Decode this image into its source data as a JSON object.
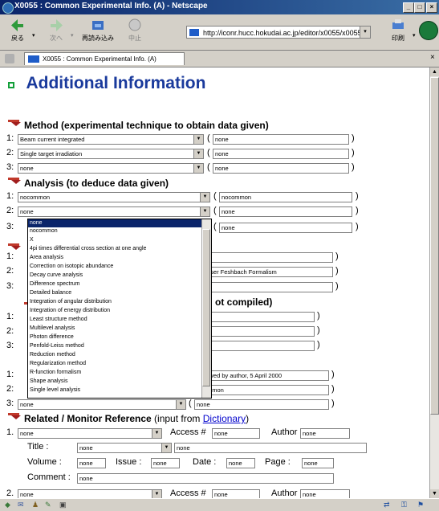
{
  "window": {
    "title": "X0055 : Common Experimental Info. (A) - Netscape",
    "minimize": "_",
    "maximize": "□",
    "close": "×"
  },
  "toolbar": {
    "back": "戻る",
    "forward": "次へ",
    "reload": "再読み込み",
    "stop": "中止",
    "print": "印刷",
    "url": "http://iconr.hucc.hokudai.ac.jp/editor/x0055/x0055-0a"
  },
  "tab": {
    "label": "X0055 : Common Experimental Info. (A)",
    "close": "×"
  },
  "page": {
    "title": "Additional Information",
    "method": {
      "heading": "Method (experimental technique to obtain data given)",
      "rows": [
        {
          "num": "1:",
          "select": "Beam current integrated",
          "input": "none"
        },
        {
          "num": "2:",
          "select": "Single target irradiation",
          "input": "none"
        },
        {
          "num": "3:",
          "select": "none",
          "input": "none"
        }
      ]
    },
    "analysis": {
      "heading": "Analysis (to deduce data given)",
      "rows": [
        {
          "num": "1:",
          "select": "nocommon",
          "input": "nocommon"
        },
        {
          "num": "2:",
          "select": "none",
          "input": "none"
        },
        {
          "num": "3:",
          "select": "",
          "input": "none"
        }
      ]
    },
    "hidden_rows": [
      {
        "num": "1:",
        "input": "e"
      },
      {
        "num": "2:",
        "input": "user Feshbach Formalism"
      },
      {
        "num": "3:",
        "input": "e"
      }
    ],
    "hidden_heading": "ot compiled)",
    "hidden_rows2": [
      {
        "num": "1:",
        "input": ""
      },
      {
        "num": "2:",
        "input": ""
      },
      {
        "num": "3:",
        "input": ""
      }
    ],
    "status_section": {
      "rows": [
        {
          "num": "1:",
          "input": "oved by author, 5 April 2000"
        },
        {
          "num": "2:",
          "input": "mmon"
        },
        {
          "num": "3:",
          "select": "none",
          "input": "none"
        }
      ]
    },
    "dropdown_options": [
      "none",
      "nocommon",
      "X",
      "4pi times differential cross section at one angle",
      "Area analysis",
      "Correction on isotopic abundance",
      "Decay curve analysis",
      "Difference spectrum",
      "Detailed balance",
      "Integration of angular distribution",
      "Integration of energy distribution",
      "Least structure method",
      "Multilevel analysis",
      "Photon difference",
      "Penfold-Leiss method",
      "Reduction method",
      "Regularization method",
      "R-function formalism",
      "Shape analysis",
      "Single level analysis"
    ],
    "related": {
      "heading": "Related / Monitor Reference",
      "heading_note": "(input from",
      "heading_link": "Dictionary",
      "heading_close": ")",
      "access_label": "Access #",
      "author_label": "Author",
      "title_label": "Title :",
      "volume_label": "Volume :",
      "issue_label": "Issue :",
      "date_label": "Date :",
      "page_label": "Page :",
      "comment_label": "Comment :",
      "entry1": {
        "num": "1.",
        "select": "none",
        "access": "none",
        "author": "none",
        "title_select": "none",
        "title_input": "none",
        "volume": "none",
        "issue": "none",
        "date": "none",
        "page": "none",
        "comment": "none"
      },
      "entry2": {
        "num": "2.",
        "select": "none",
        "access": "none",
        "author": "none"
      }
    }
  }
}
